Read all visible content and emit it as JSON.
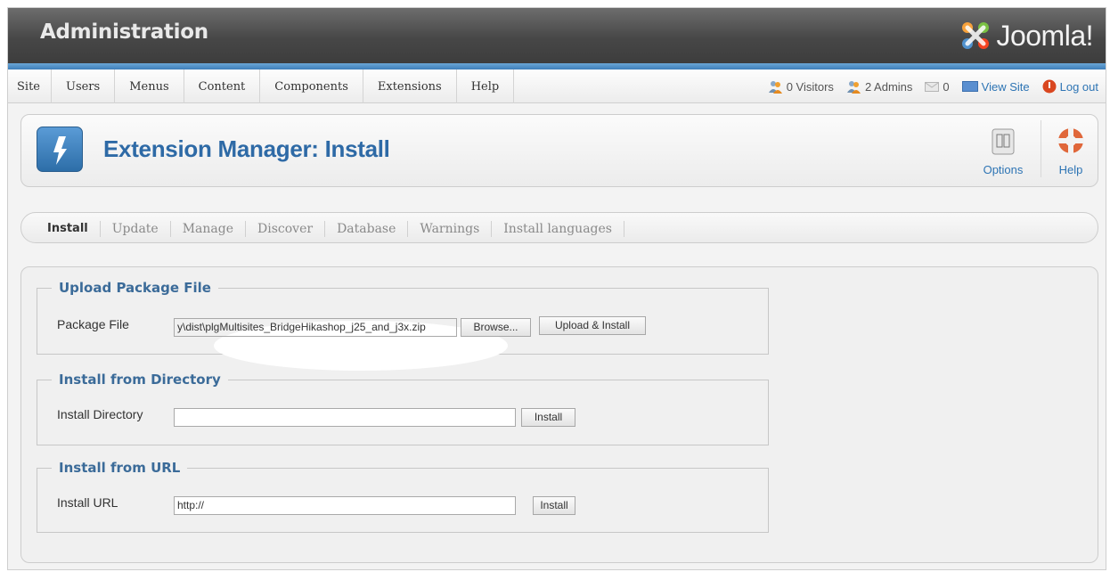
{
  "header": {
    "title": "Administration",
    "logo_text": "Joomla!"
  },
  "menu": {
    "items": [
      "Site",
      "Users",
      "Menus",
      "Content",
      "Components",
      "Extensions",
      "Help"
    ]
  },
  "status": {
    "visitors": "0 Visitors",
    "admins": "2 Admins",
    "messages": "0",
    "view_site": "View Site",
    "logout": "Log out"
  },
  "toolbar": {
    "title": "Extension Manager: Install",
    "options_label": "Options",
    "help_label": "Help"
  },
  "tabs": {
    "items": [
      "Install",
      "Update",
      "Manage",
      "Discover",
      "Database",
      "Warnings",
      "Install languages"
    ],
    "active": "Install"
  },
  "upload": {
    "legend": "Upload Package File",
    "label": "Package File",
    "value": "y\\dist\\plgMultisites_BridgeHikashop_j25_and_j3x.zip",
    "browse": "Browse...",
    "submit": "Upload & Install"
  },
  "directory": {
    "legend": "Install from Directory",
    "label": "Install Directory",
    "value": "",
    "submit": "Install"
  },
  "url": {
    "legend": "Install from URL",
    "label": "Install URL",
    "value": "http://",
    "submit": "Install"
  },
  "colors": {
    "accent": "#2e6aa6",
    "header_bg": "#4a4a4a",
    "header_stripe": "#4f8fc8",
    "legend": "#3b6b99"
  }
}
